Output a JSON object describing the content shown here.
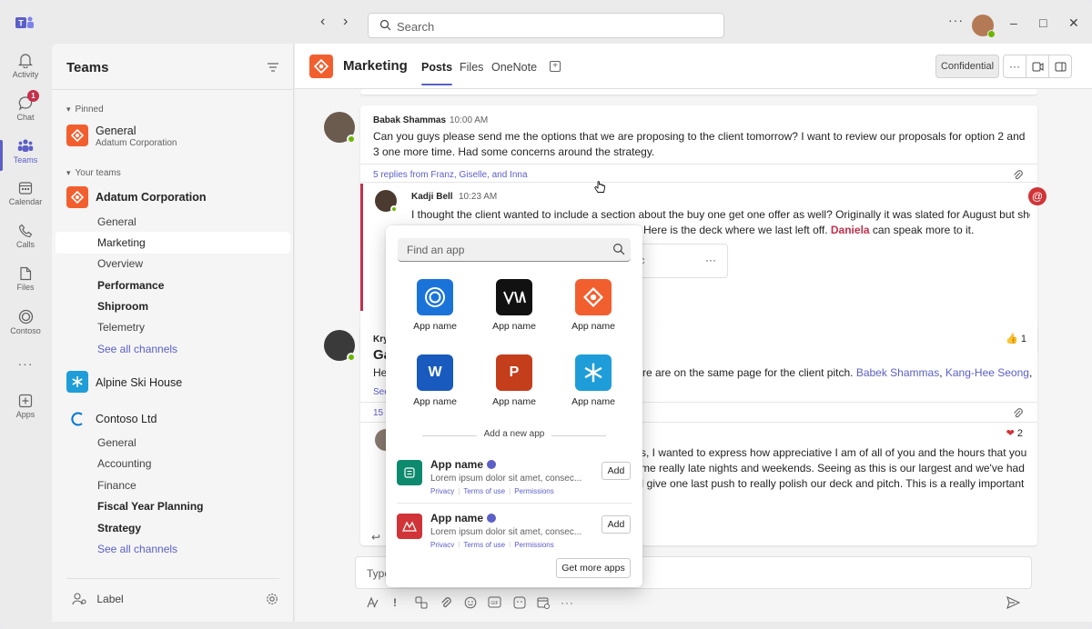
{
  "titlebar": {
    "search_placeholder": "Search",
    "back": "‹",
    "forward": "›",
    "more": "···",
    "minimize": "–",
    "maximize": "□",
    "close": "✕"
  },
  "rail": [
    {
      "label": "Activity",
      "icon": "bell-icon"
    },
    {
      "label": "Chat",
      "icon": "chat-icon",
      "badge": "1"
    },
    {
      "label": "Teams",
      "icon": "teams-icon"
    },
    {
      "label": "Calendar",
      "icon": "calendar-icon"
    },
    {
      "label": "Calls",
      "icon": "phone-icon"
    },
    {
      "label": "Files",
      "icon": "file-icon"
    },
    {
      "label": "Contoso",
      "icon": "contoso-icon"
    },
    {
      "label": "Apps",
      "icon": "apps-icon"
    }
  ],
  "teams_panel": {
    "title": "Teams",
    "pinned_label": "Pinned",
    "pinned": {
      "name": "General",
      "sub": "Adatum Corporation"
    },
    "your_teams_label": "Your teams",
    "team1": {
      "name": "Adatum Corporation",
      "channels": [
        "General",
        "Marketing",
        "Overview",
        "Performance",
        "Shiproom",
        "Telemetry"
      ],
      "see_all": "See all channels"
    },
    "team2": {
      "name": "Alpine Ski House"
    },
    "team3": {
      "name": "Contoso Ltd",
      "channels": [
        "General",
        "Accounting",
        "Finance",
        "Fiscal Year Planning",
        "Strategy"
      ],
      "see_all": "See all channels"
    },
    "label": "Label"
  },
  "channel_header": {
    "title": "Marketing",
    "tabs": [
      "Posts",
      "Files",
      "OneNote"
    ],
    "confidential": "Confidential",
    "more": "···"
  },
  "thread1": {
    "sender": "Babak Shammas",
    "time": "10:00 AM",
    "text": "Can you guys please send me the options that we are proposing to the client tomorrow? I want to review our proposals for option 2 and 3 one more time. Had some concerns around the strategy.",
    "replies": "5 replies from Franz, Giselle, and Inna",
    "reply": {
      "sender": "Kadji Bell",
      "time": "10:23 AM",
      "text1": "I thought the client wanted to include a section about the buy one get one offer as well? Originally it was slated for August but she",
      "text2a": "Here is the deck where we last left off.",
      "mention": "Daniela",
      "text2b": "can speak more to it.",
      "file_partial": "c"
    }
  },
  "thread2": {
    "sender_partial": "Kry",
    "title_partial": "Ga",
    "text_start": "He",
    "text_end": "re are on the same page for the client pitch.",
    "mention1": "Babek Shammas",
    "mention2": "Kang-Hee Seong",
    "see_partial": "See",
    "replies_partial": "15",
    "reaction": "1",
    "reply": {
      "reaction": "2",
      "line1": "s, I wanted to express how appreciative I am of all of you and the hours that you",
      "line2": "me really late nights and weekends. Seeing as this is our largest and we've had",
      "line3": "I give one last push to really polish our deck and pitch. This is a really important"
    }
  },
  "compose": {
    "placeholder": "Type"
  },
  "app_picker": {
    "search_placeholder": "Find an app",
    "apps": [
      {
        "name": "App name",
        "icon": "ring-icon",
        "color": "#1a73d9"
      },
      {
        "name": "App name",
        "icon": "va-icon",
        "color": "#111111"
      },
      {
        "name": "App name",
        "icon": "link-icon",
        "color": "#f25f2f"
      },
      {
        "name": "App name",
        "icon": "word-icon",
        "color": "#185abd"
      },
      {
        "name": "App name",
        "icon": "powerpoint-icon",
        "color": "#c43e1c"
      },
      {
        "name": "App name",
        "icon": "snowflake-icon",
        "color": "#1e9dd8"
      }
    ],
    "add_new_label": "Add a new app",
    "suggestions": [
      {
        "title": "App name",
        "desc": "Lorem ipsum dolor sit amet, consec...",
        "links": [
          "Privacy",
          "Terms of use",
          "Permissions"
        ],
        "add": "Add",
        "color": "#0e8a6e"
      },
      {
        "title": "App name",
        "desc": "Lorem ipsum dolor sit amet, consec...",
        "links": [
          "Privacy",
          "Terms of use",
          "Permissions"
        ],
        "add": "Add",
        "color": "#d13438"
      }
    ],
    "get_more": "Get more apps"
  }
}
